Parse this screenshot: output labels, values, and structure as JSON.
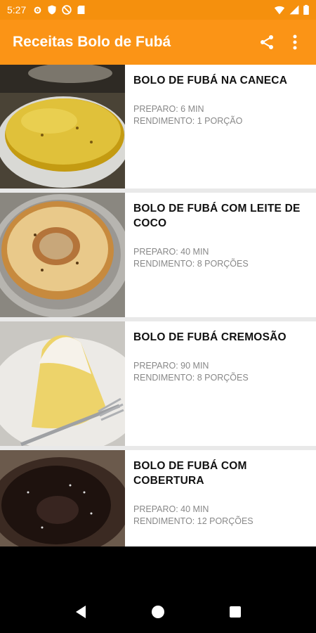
{
  "status": {
    "time": "5:27"
  },
  "appbar": {
    "title": "Receitas Bolo de Fubá",
    "share_icon": "share-icon",
    "menu_icon": "more-vert-icon"
  },
  "colors": {
    "primary": "#fb9416",
    "status": "#f5900d"
  },
  "recipes": [
    {
      "name": "BOLO DE FUBÁ NA CANECA",
      "preparo": "PREPARO: 6 MIN",
      "rendimento": "RENDIMENTO: 1 PORÇÃO"
    },
    {
      "name": "BOLO DE FUBÁ COM LEITE DE COCO",
      "preparo": "PREPARO: 40 MIN",
      "rendimento": "RENDIMENTO: 8 PORÇÕES"
    },
    {
      "name": "BOLO DE FUBÁ CREMOSÃO",
      "preparo": "PREPARO: 90 MIN",
      "rendimento": "RENDIMENTO: 8 PORÇÕES"
    },
    {
      "name": "BOLO DE FUBÁ COM COBERTURA",
      "preparo": "PREPARO: 40 MIN",
      "rendimento": "RENDIMENTO: 12 PORÇÕES"
    }
  ]
}
